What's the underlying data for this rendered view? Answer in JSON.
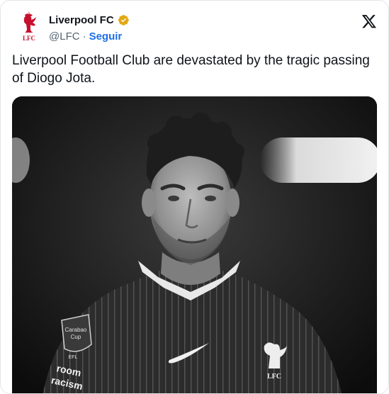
{
  "account": {
    "display_name": "Liverpool FC",
    "handle": "@LFC",
    "separator": "·",
    "follow_label": "Seguir",
    "avatar_text": "LFC",
    "verified_icon": "gold-verified-badge-icon",
    "verified_color": "#e2a812"
  },
  "platform_icon": "x-logo-icon",
  "tweet": {
    "text": "Liverpool Football Club are devastated by the tragic passing of Diogo Jota."
  },
  "media": {
    "style": "black-and-white photo",
    "badge_lines": [
      "Carabao",
      "Cup"
    ],
    "badge_small": "EFL",
    "sponsor_lines": [
      "room",
      "racism"
    ],
    "crest_text": "LFC"
  },
  "colors": {
    "text": "#0f1419",
    "secondary": "#536471",
    "link": "#1d6ee8",
    "crest_red": "#c8102e"
  }
}
